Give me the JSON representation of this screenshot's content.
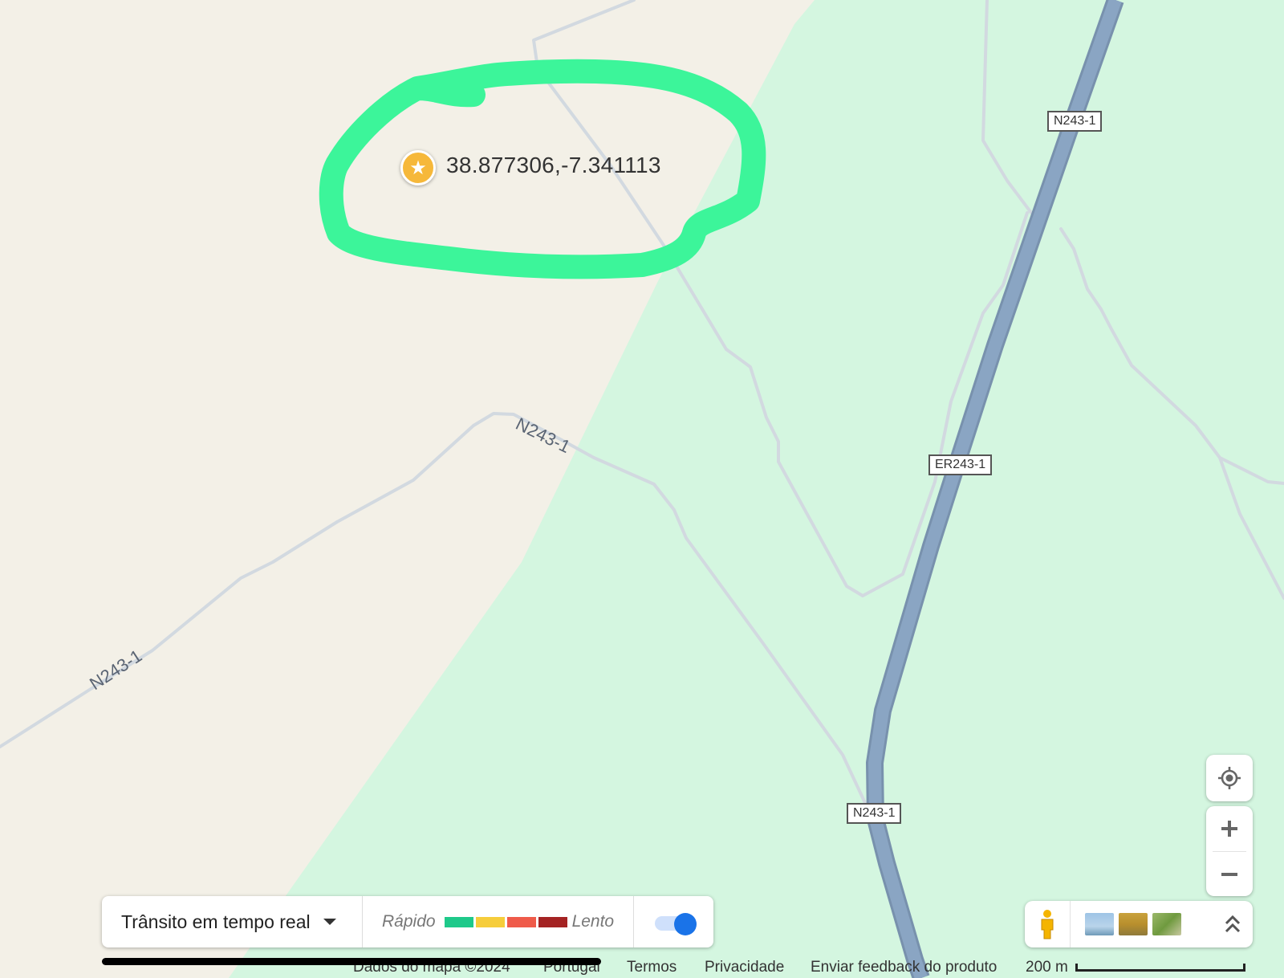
{
  "map": {
    "coordinates_label": "38.877306,-7.341113",
    "road_shields": [
      "N243-1",
      "ER243-1",
      "N243-1"
    ],
    "road_labels": [
      "N243-1",
      "N243-1"
    ],
    "colors": {
      "land": "#f3f0e7",
      "park": "#d4f6e0",
      "highway": "#8aa5c3",
      "road": "#d2d9e0",
      "highlight": "#3cf59a",
      "pin": "#f6b83a"
    },
    "pin_icon": "star-icon"
  },
  "traffic_panel": {
    "title": "Trânsito em tempo real",
    "fast_label": "Rápido",
    "slow_label": "Lento",
    "legend_colors": [
      "#1ec98a",
      "#f6cd3b",
      "#ef5b4a",
      "#a42323"
    ],
    "toggle_on": true
  },
  "controls": {
    "locate_icon": "my-location-icon",
    "zoom_in_icon": "plus-icon",
    "zoom_out_icon": "minus-icon",
    "pegman_icon": "pegman-icon",
    "expand_icon": "double-chevron-up-icon"
  },
  "footer": {
    "data_credit": "Dados do mapa ©2024",
    "country": "Portugal",
    "terms": "Termos",
    "privacy": "Privacidade",
    "feedback": "Enviar feedback do produto",
    "scale": "200 m"
  }
}
